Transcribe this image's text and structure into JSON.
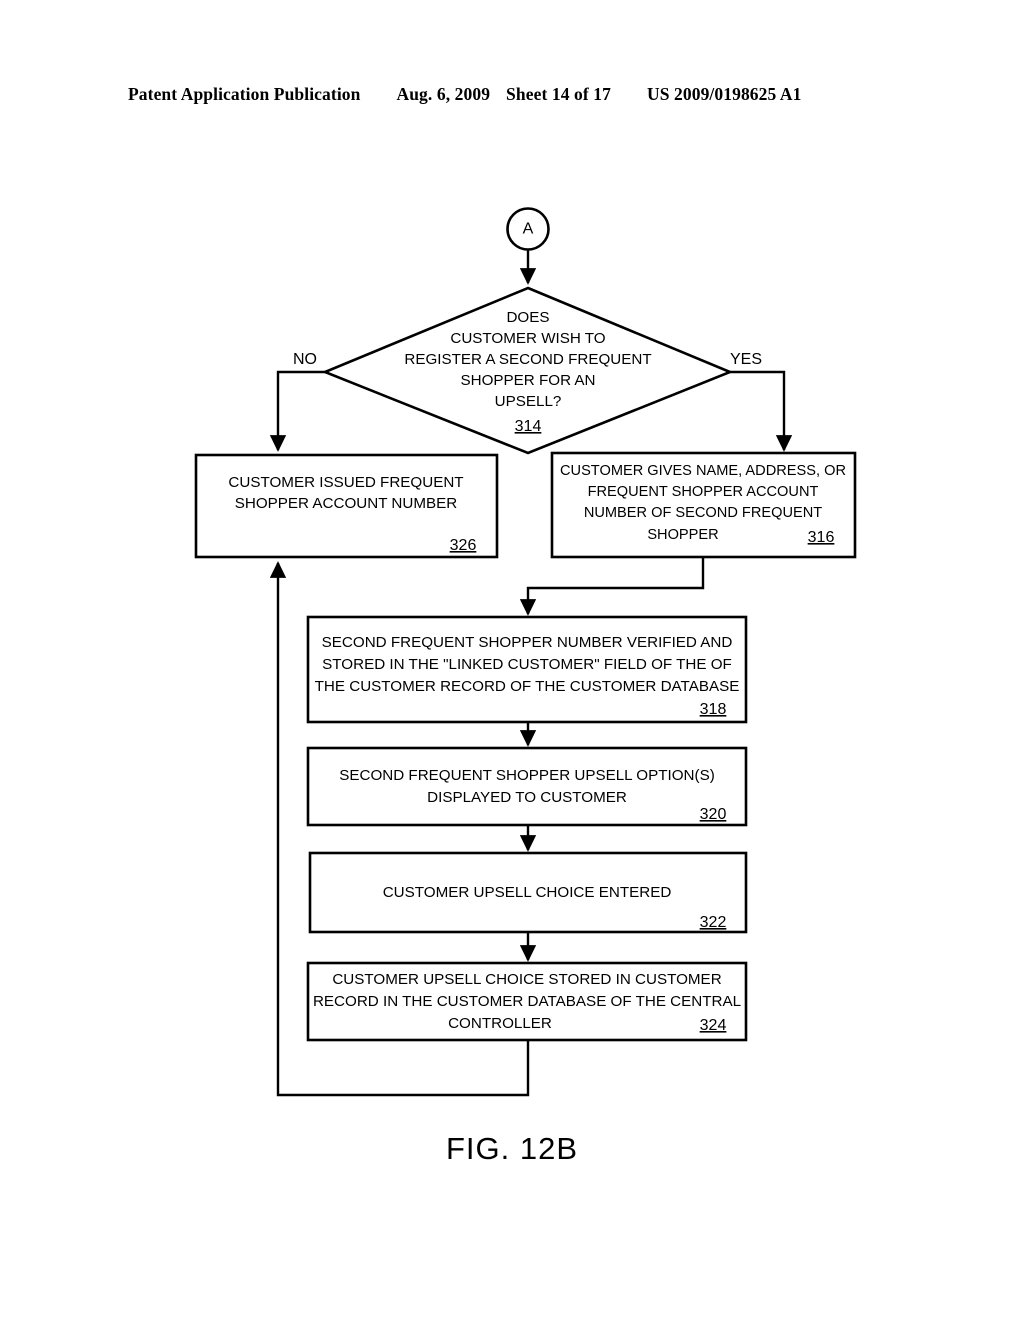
{
  "header": {
    "publication": "Patent Application Publication",
    "date": "Aug. 6, 2009",
    "sheet": "Sheet 14 of 17",
    "number": "US 2009/0198625 A1"
  },
  "figure": {
    "caption": "FIG. 12B"
  },
  "flowchart": {
    "connector": {
      "label": "A"
    },
    "decision": {
      "ref": "314",
      "lines": [
        "DOES",
        "CUSTOMER WISH TO",
        "REGISTER A SECOND FREQUENT",
        "SHOPPER FOR AN",
        "UPSELL?"
      ],
      "branch_no": "NO",
      "branch_yes": "YES"
    },
    "boxes": [
      {
        "ref": "326",
        "lines": [
          "CUSTOMER ISSUED FREQUENT",
          "SHOPPER ACCOUNT NUMBER"
        ]
      },
      {
        "ref": "316",
        "lines": [
          "CUSTOMER GIVES NAME, ADDRESS, OR",
          "FREQUENT SHOPPER ACCOUNT",
          "NUMBER OF SECOND FREQUENT",
          "SHOPPER"
        ]
      },
      {
        "ref": "318",
        "lines": [
          "SECOND FREQUENT SHOPPER NUMBER VERIFIED AND",
          "STORED IN THE \"LINKED CUSTOMER\" FIELD OF THE OF",
          "THE CUSTOMER RECORD OF THE CUSTOMER DATABASE"
        ]
      },
      {
        "ref": "320",
        "lines": [
          "SECOND FREQUENT SHOPPER UPSELL OPTION(S)",
          "DISPLAYED TO CUSTOMER"
        ]
      },
      {
        "ref": "322",
        "lines": [
          "CUSTOMER UPSELL CHOICE ENTERED"
        ]
      },
      {
        "ref": "324",
        "lines": [
          "CUSTOMER UPSELL CHOICE STORED IN CUSTOMER",
          "RECORD IN THE CUSTOMER DATABASE OF THE CENTRAL",
          "CONTROLLER"
        ]
      }
    ]
  },
  "colors": {
    "ink": "#000000",
    "paper": "#ffffff"
  }
}
